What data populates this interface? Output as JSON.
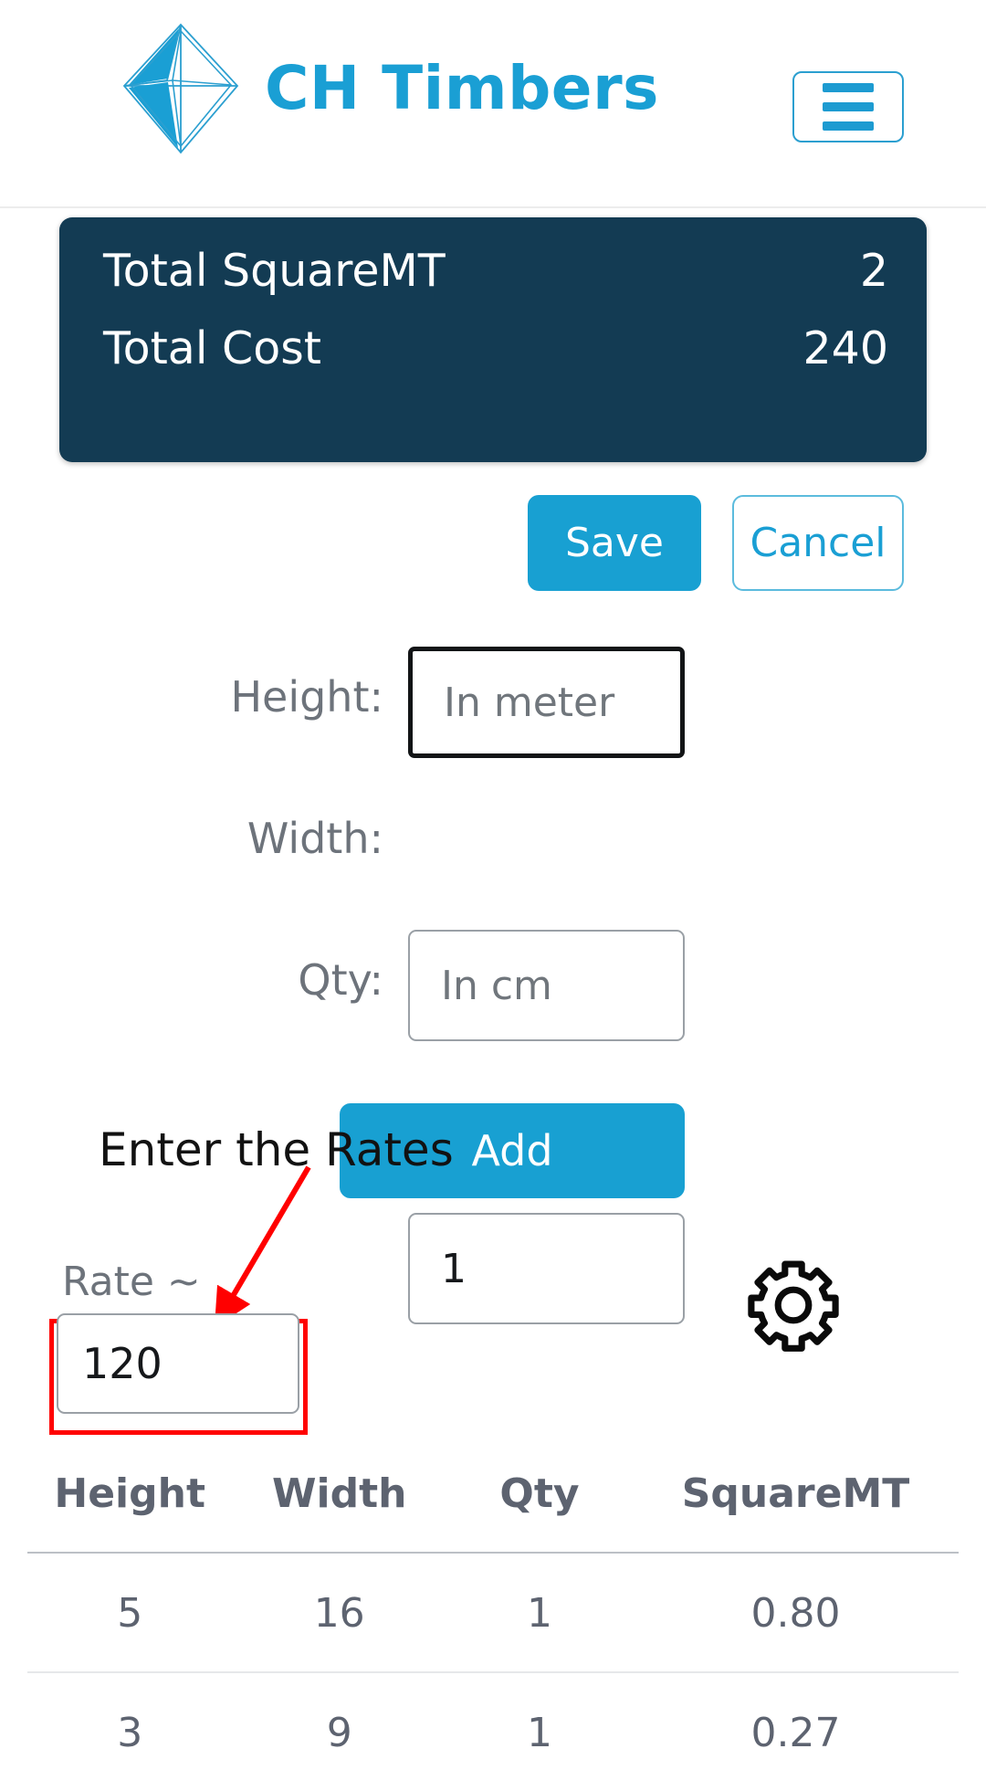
{
  "header": {
    "brand_name": "CH Timbers",
    "logo_icon": "diamond-octahedron-logo",
    "menu_icon": "hamburger-menu-icon"
  },
  "summary": {
    "total_label": "Total SquareMT",
    "total_value": "2",
    "cost_label": "Total Cost",
    "cost_value": "240",
    "background_color": "#133b53"
  },
  "actions": {
    "save_label": "Save",
    "cancel_label": "Cancel",
    "primary_color": "#18a0d2"
  },
  "form": {
    "height": {
      "label": "Height:",
      "placeholder": "In meter",
      "value": ""
    },
    "width": {
      "label": "Width:",
      "placeholder": "In cm",
      "value": ""
    },
    "qty": {
      "label": "Qty:",
      "placeholder": "",
      "value": "1"
    },
    "add_label": "Add"
  },
  "annotation": {
    "text": "Enter the Rates",
    "color": "#ff0000"
  },
  "rate": {
    "label": "Rate ~",
    "value": "120",
    "placeholder": ""
  },
  "settings": {
    "icon": "gear-icon"
  },
  "table": {
    "columns": [
      "Height",
      "Width",
      "Qty",
      "SquareMT"
    ],
    "rows": [
      [
        "5",
        "16",
        "1",
        "0.80"
      ],
      [
        "3",
        "9",
        "1",
        "0.27"
      ]
    ]
  }
}
